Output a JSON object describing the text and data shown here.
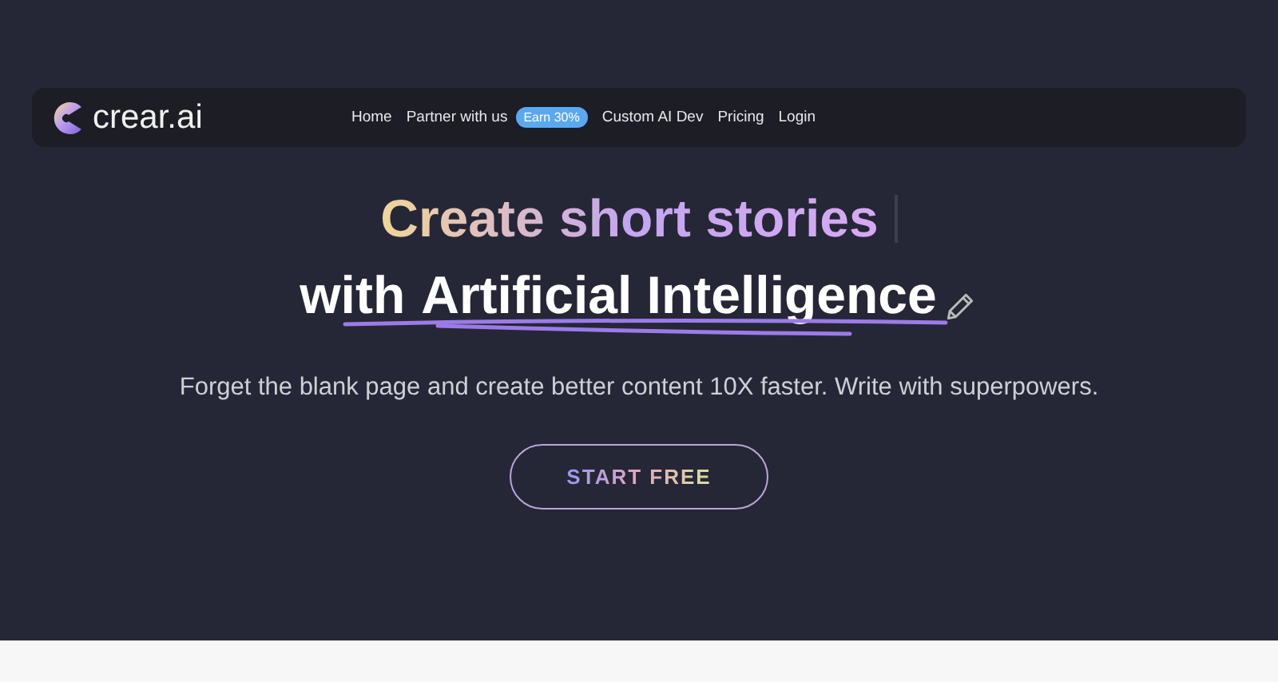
{
  "nav": {
    "logo": "crear.ai",
    "items": [
      {
        "label": "Home"
      },
      {
        "label": "Partner with us",
        "badge": "Earn 30%"
      },
      {
        "label": "Custom AI Dev"
      },
      {
        "label": "Pricing"
      },
      {
        "label": "Login"
      }
    ]
  },
  "hero": {
    "headline": "Create short stories",
    "subline_prefix": "with",
    "subline_highlight": "Artificial Intelligence",
    "description": "Forget the blank page and create better content 10X faster. Write with superpowers.",
    "cta": "START FREE"
  }
}
